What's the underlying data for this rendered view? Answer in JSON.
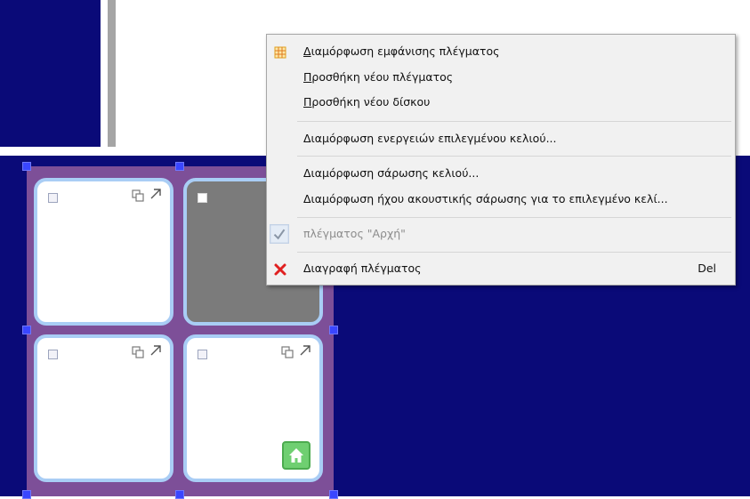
{
  "menu": {
    "items": [
      {
        "label": "Διαμόρφωση εμφάνισης πλέγματος",
        "icon": "grid-table-icon",
        "underline_first": true
      },
      {
        "label": "Προσθήκη νέου πλέγματος",
        "underline_first": true
      },
      {
        "label": "Προσθήκη νέου δίσκου",
        "underline_first": true
      },
      {
        "label": "Διαμόρφωση ενεργειών επιλεγμένου κελιού..."
      },
      {
        "label": "Διαμόρφωση σάρωσης κελιού..."
      },
      {
        "label": "Διαμόρφωση ήχου ακουστικής σάρωσης για το επιλεγμένο κελί..."
      },
      {
        "label": "πλέγματος \"Αρχή\"",
        "icon": "checkmark-icon",
        "disabled": true
      },
      {
        "label": "Διαγραφή πλέγματος",
        "icon": "red-x-delete-icon",
        "shortcut": "Del"
      }
    ]
  },
  "grid": {
    "cells": [
      {
        "state": "normal",
        "icons": [
          "checkbox-icon",
          "copy-icon",
          "link-arrow-icon"
        ]
      },
      {
        "state": "selected-gray",
        "icons": [
          "checkbox-icon"
        ]
      },
      {
        "state": "normal",
        "icons": [
          "checkbox-icon",
          "copy-icon",
          "link-arrow-icon"
        ]
      },
      {
        "state": "normal",
        "icons": [
          "checkbox-icon",
          "copy-icon",
          "link-arrow-icon",
          "home-icon"
        ]
      }
    ]
  },
  "colors": {
    "canvas_navy": "#0a0a78",
    "grid_frame": "#7d4f98",
    "cell_border": "#a9cdf5",
    "handle": "#3a46ff",
    "home_green": "#6fcf71",
    "delete_red": "#e02020"
  }
}
